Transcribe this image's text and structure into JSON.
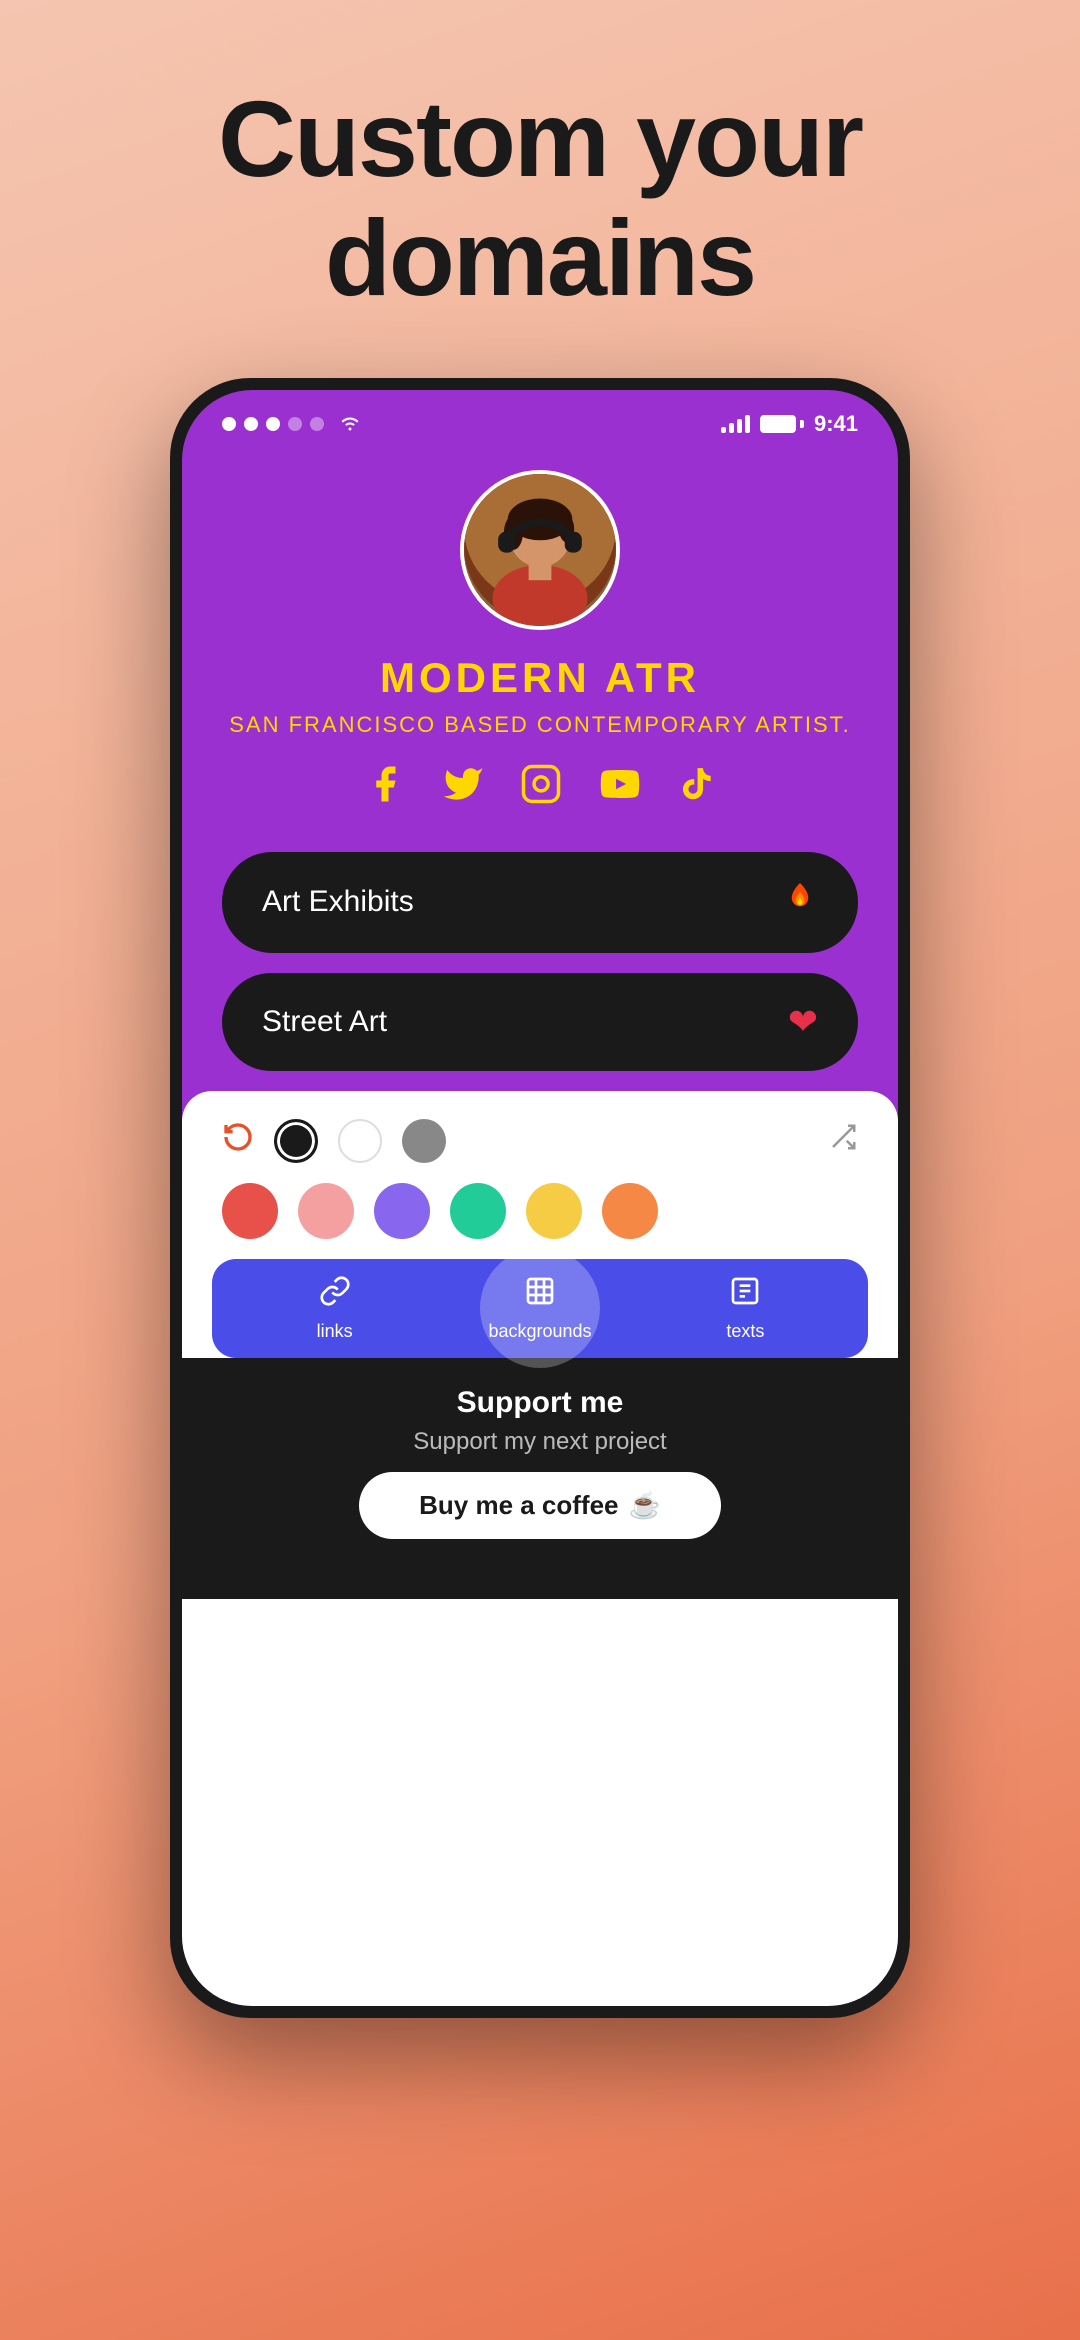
{
  "page": {
    "title_line1": "Custom your",
    "title_line2": "domains",
    "background_gradient_start": "#f5c5b0",
    "background_gradient_end": "#e8704a"
  },
  "status_bar": {
    "time": "9:41",
    "dots": [
      {
        "filled": true
      },
      {
        "filled": true
      },
      {
        "filled": true
      },
      {
        "filled": false
      },
      {
        "filled": false
      }
    ]
  },
  "profile": {
    "name": "MODERN ATR",
    "subtitle": "SAN FRANCISCO BASED CONTEMPORARY ARTIST.",
    "accent_color": "#FFD700"
  },
  "social": {
    "icons": [
      "facebook",
      "twitter",
      "instagram",
      "youtube",
      "tiktok"
    ]
  },
  "links": [
    {
      "label": "Art Exhibits",
      "icon": "fire"
    },
    {
      "label": "Street Art",
      "icon": "heart"
    }
  ],
  "color_panel": {
    "reset_label": "↺",
    "main_colors": [
      {
        "color": "#1a1a1a",
        "selected": true
      },
      {
        "color": "#ffffff",
        "selected": false
      },
      {
        "color": "#888888",
        "selected": false
      }
    ],
    "swatches": [
      {
        "color": "#e8504a"
      },
      {
        "color": "#f5a0a0"
      },
      {
        "color": "#8866ee"
      },
      {
        "color": "#22cc99"
      },
      {
        "color": "#f5cc44"
      },
      {
        "color": "#f58844"
      }
    ]
  },
  "tabs": [
    {
      "id": "links",
      "label": "links",
      "icon": "links"
    },
    {
      "id": "backgrounds",
      "label": "backgrounds",
      "icon": "backgrounds",
      "active": true
    },
    {
      "id": "texts",
      "label": "texts",
      "icon": "texts"
    }
  ],
  "support": {
    "title": "Support me",
    "subtitle": "Support my next project",
    "button_label": "Buy me a coffee",
    "button_emoji": "☕"
  }
}
